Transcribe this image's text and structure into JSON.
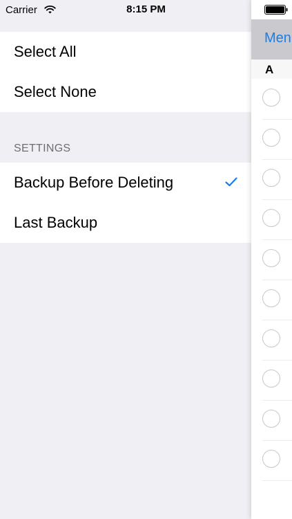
{
  "status_bar": {
    "carrier": "Carrier",
    "time": "8:15 PM"
  },
  "menu": {
    "group_actions": [
      {
        "label": "Select All"
      },
      {
        "label": "Select None"
      }
    ],
    "settings_header": "SETTINGS",
    "group_settings": [
      {
        "label": "Backup Before Deleting",
        "checked": true
      },
      {
        "label": "Last Backup",
        "checked": false
      }
    ]
  },
  "content": {
    "nav_button_label": "Menu",
    "index_letter": "A",
    "row_count": 10
  },
  "colors": {
    "accent": "#1a7ee8",
    "background": "#efeff4",
    "section_text": "#6d6d72",
    "circle_border": "#c8c7cc"
  },
  "icons": [
    "wifi-icon",
    "checkmark-icon",
    "battery-icon",
    "select-circle-icon"
  ]
}
